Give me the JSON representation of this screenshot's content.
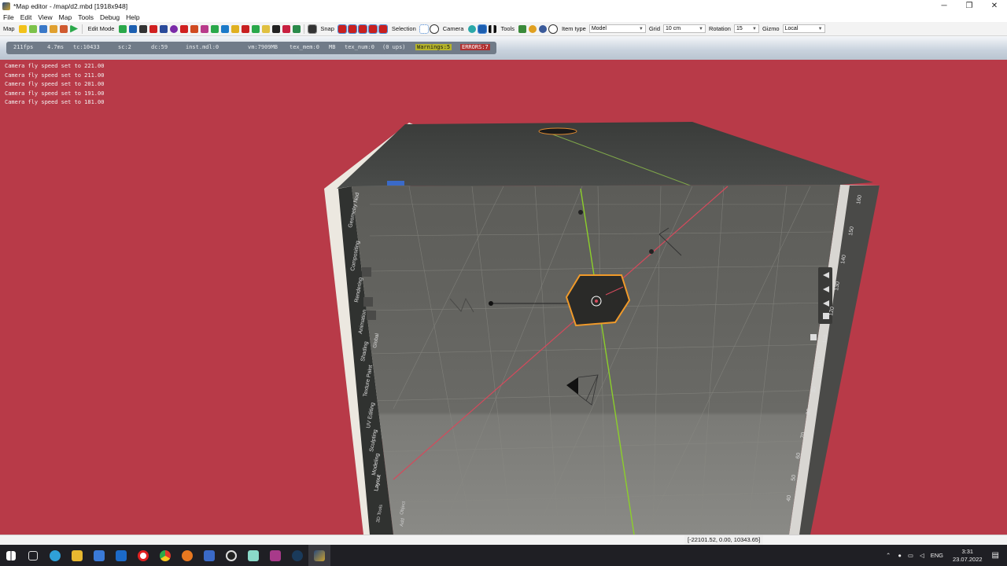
{
  "window": {
    "title": "*Map editor - /map/d2.mbd [1918x948]",
    "controls": {
      "minimize": "─",
      "restore": "❐",
      "close": "✕"
    }
  },
  "menu": [
    "File",
    "Edit",
    "View",
    "Map",
    "Tools",
    "Debug",
    "Help"
  ],
  "toolbar": {
    "map_label": "Map",
    "edit_mode_label": "Edit Mode",
    "snap_label": "Snap",
    "selection_label": "Selection",
    "camera_label": "Camera",
    "tools_label": "Tools",
    "item_type_label": "Item type",
    "item_type_value": "Model",
    "grid_label": "Grid",
    "grid_value": "10 cm",
    "rotation_label": "Rotation",
    "rotation_value": "15",
    "gizmo_label": "Gizmo",
    "gizmo_value": "Local"
  },
  "stats": {
    "fps": "211fps",
    "frame_ms": "4.7ms",
    "tc": "tc:10433",
    "sc": "sc:2",
    "dc": "dc:59",
    "inst": "inst.mdl:0",
    "vm": "vm:7909MB",
    "tex_mem": "tex_mem:0",
    "tex_mem_unit": "MB",
    "tex_num": "tex_num:0",
    "ups": "(0 ups)",
    "warnings": "Warnings:5",
    "errors": "ERRORS:7"
  },
  "log": [
    "Camera fly speed set to 221.00",
    "Camera fly speed set to 211.00",
    "Camera fly speed set to 201.00",
    "Camera fly speed set to 191.00",
    "Camera fly speed set to 181.00"
  ],
  "viewport": {
    "left_tabs": [
      "Geometry Nod",
      "Compositing",
      "Rendering",
      "Animation",
      "Shading",
      "Texture Paint",
      "UV Editing",
      "Sculpting",
      "Modeling",
      "Layout"
    ],
    "bottom_tabs": [
      "Add",
      "Object"
    ],
    "sidebar_bottom": "3D Tools",
    "transform_label": "Global",
    "ruler_labels": [
      "160",
      "150",
      "140",
      "130",
      "120",
      "110",
      "100",
      "90",
      "80",
      "70",
      "60",
      "50",
      "40"
    ],
    "colors": {
      "background": "#b83a48",
      "axis_x": "#d44a5c",
      "axis_y": "#8ccf2a",
      "selection": "#f09a2a"
    }
  },
  "coordinates": "[-22101.52, 0.00, 10343.65]",
  "taskbar": {
    "language": "ENG",
    "time": "3:31",
    "date": "23.07.2022"
  }
}
